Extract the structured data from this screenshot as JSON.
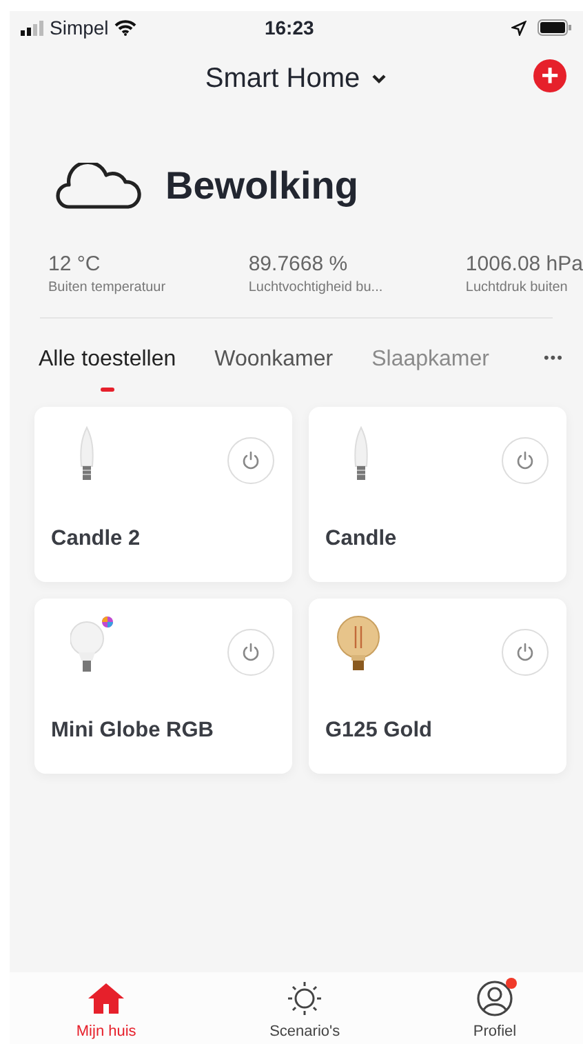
{
  "status_bar": {
    "carrier": "Simpel",
    "time": "16:23"
  },
  "header": {
    "title": "Smart Home",
    "add_button": "+"
  },
  "weather": {
    "condition": "Bewolking"
  },
  "stats": [
    {
      "value": "12 °C",
      "label": "Buiten temperatuur"
    },
    {
      "value": "89.7668 %",
      "label": "Luchtvochtigheid bu..."
    },
    {
      "value": "1006.08 hPa",
      "label": "Luchtdruk buiten"
    }
  ],
  "tabs": [
    {
      "label": "Alle toestellen",
      "selected": true
    },
    {
      "label": "Woonkamer",
      "selected": false
    },
    {
      "label": "Slaapkamer",
      "selected": false
    }
  ],
  "more_button": "•••",
  "devices": [
    {
      "name": "Candle 2",
      "kind": "candle"
    },
    {
      "name": "Candle",
      "kind": "candle"
    },
    {
      "name": "Mini Globe RGB",
      "kind": "rgb-globe"
    },
    {
      "name": "G125 Gold",
      "kind": "filament"
    }
  ],
  "bottom_nav": [
    {
      "label": "Mijn huis",
      "kind": "home",
      "selected": true,
      "notification": false
    },
    {
      "label": "Scenario's",
      "kind": "scene",
      "selected": false,
      "notification": false
    },
    {
      "label": "Profiel",
      "kind": "profile",
      "selected": false,
      "notification": true
    }
  ]
}
